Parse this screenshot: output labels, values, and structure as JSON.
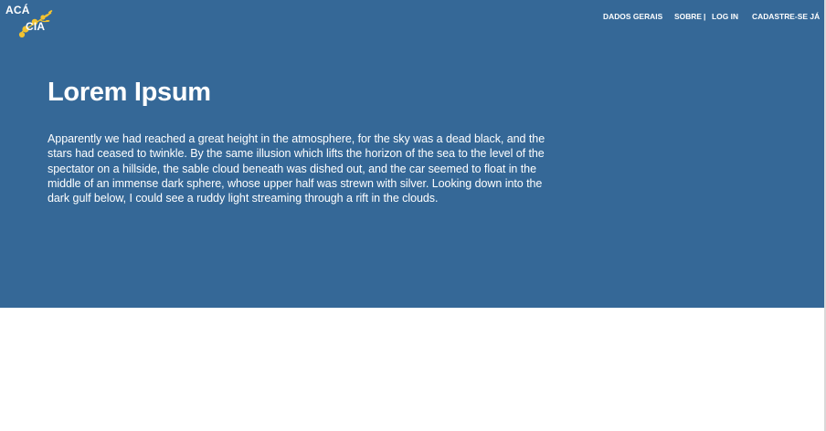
{
  "logo": {
    "line1": "ACÁ",
    "line2": "CIA",
    "accent_color": "#F2C230"
  },
  "nav": {
    "items": [
      {
        "label": "DADOS GERAIS"
      },
      {
        "label": "SOBRE"
      },
      {
        "label": "LOG IN"
      },
      {
        "label": "CADASTRE-SE JÁ"
      }
    ],
    "separator": "|"
  },
  "hero": {
    "title": "Lorem Ipsum",
    "body": "Apparently we had reached a great height in the atmosphere, for the sky was a dead black, and the stars had ceased to twinkle. By the same illusion which lifts the horizon of the sea to the level of the spectator on a hillside, the sable cloud beneath was dished out, and the car seemed to float in the middle of an immense dark sphere, whose upper half was strewn with silver. Looking down into the dark gulf below, I could see a ruddy light streaming through a rift in the clouds.",
    "background_color": "#356897"
  }
}
